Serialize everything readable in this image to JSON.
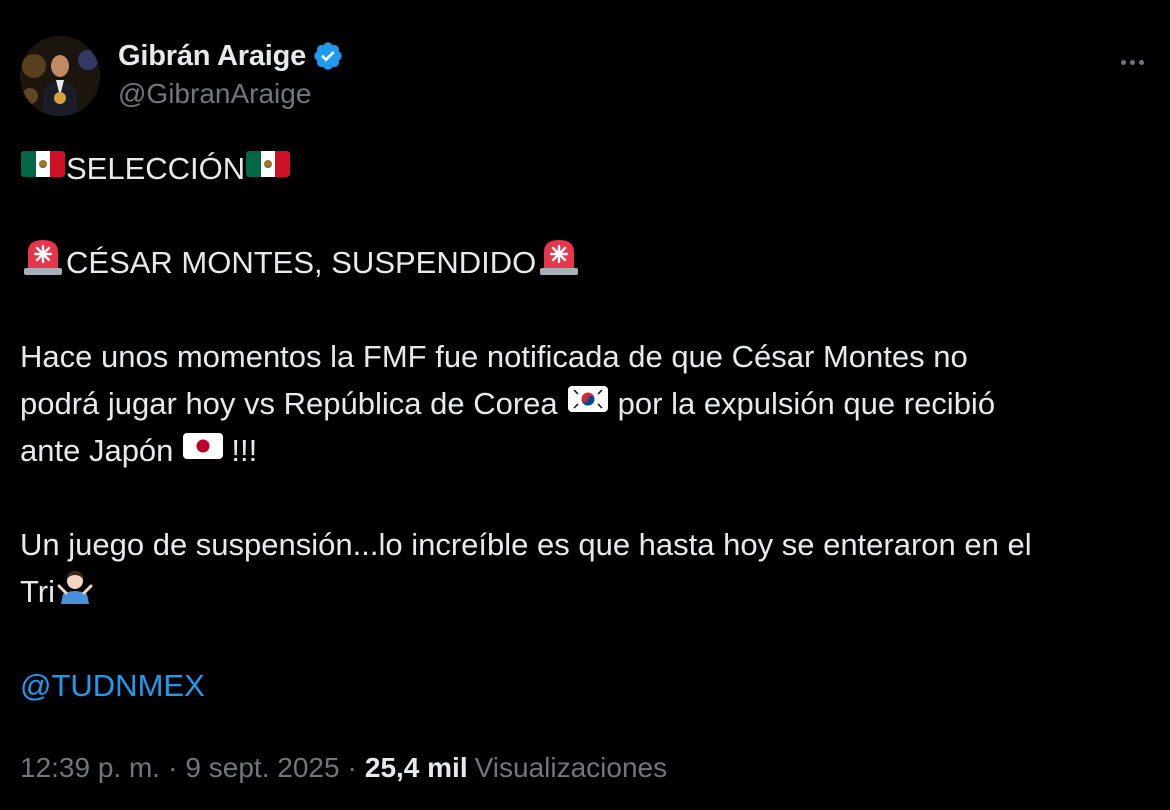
{
  "author": {
    "display_name": "Gibrán Araige",
    "handle": "@GibranAraige",
    "verified": true,
    "avatar_icon": "profile-photo"
  },
  "tweet": {
    "line1_text": "SELECCIÓN",
    "line2_text": "CÉSAR MONTES, SUSPENDIDO",
    "para3_line1": "Hace unos momentos la FMF fue notificada de que César Montes no",
    "para3_line2_a": "podrá jugar hoy vs República de Corea",
    "para3_line2_b": "por la expulsión que recibió",
    "para3_line3_a": "ante Japón",
    "para3_line3_b": "!!!",
    "para4_line1": "Un juego de suspensión...lo increíble es que hasta hoy se enteraron en el",
    "para4_line2": "Tri",
    "mention": "@TUDNMEX",
    "emojis": {
      "mexico_flag": "mexico-flag-icon",
      "siren": "rotating-light-icon",
      "korea_flag": "south-korea-flag-icon",
      "japan_flag": "japan-flag-icon",
      "shrug": "person-shrugging-icon"
    }
  },
  "meta": {
    "time": "12:39 p. m.",
    "date": "9 sept. 2025",
    "separator": "·",
    "views_count": "25,4 mil",
    "views_label": "Visualizaciones"
  },
  "colors": {
    "background": "#000000",
    "text": "#e7e9ea",
    "secondary": "#71767b",
    "accent": "#1d9bf0"
  }
}
